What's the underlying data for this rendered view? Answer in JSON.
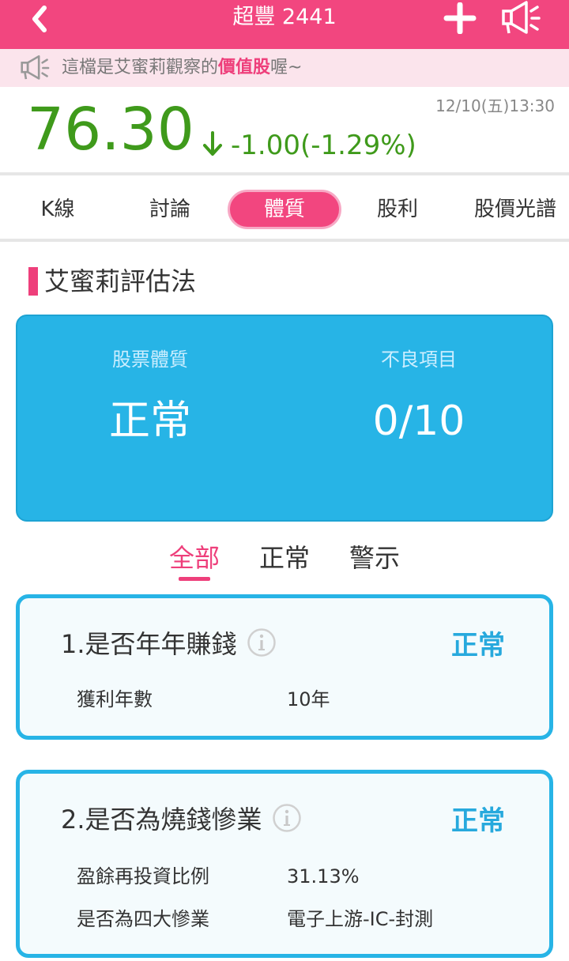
{
  "header": {
    "title": "超豐 2441",
    "back_icon": "chevron-left-icon",
    "add_icon": "plus-icon",
    "announce_icon": "megaphone-icon"
  },
  "notice": {
    "prefix": "這檔是艾蜜莉觀察的",
    "highlight": "價值股",
    "suffix": "喔~"
  },
  "quote": {
    "price": "76.30",
    "change": "-1.00(-1.29%)",
    "timestamp": "12/10(五)13:30"
  },
  "tabs": [
    {
      "label": "K線",
      "active": false
    },
    {
      "label": "討論",
      "active": false
    },
    {
      "label": "體質",
      "active": true
    },
    {
      "label": "股利",
      "active": false
    },
    {
      "label": "股價光譜",
      "active": false
    }
  ],
  "section": {
    "title": "艾蜜莉評估法"
  },
  "summary": {
    "left_label": "股票體質",
    "left_value": "正常",
    "right_label": "不良項目",
    "right_value": "0/10"
  },
  "filters": [
    {
      "label": "全部",
      "active": true
    },
    {
      "label": "正常",
      "active": false
    },
    {
      "label": "警示",
      "active": false
    }
  ],
  "cards": [
    {
      "title": "1.是否年年賺錢",
      "status": "正常",
      "rows": [
        {
          "key": "獲利年數",
          "value": "10年"
        }
      ]
    },
    {
      "title": "2.是否為燒錢慘業",
      "status": "正常",
      "rows": [
        {
          "key": "盈餘再投資比例",
          "value": "31.13%"
        },
        {
          "key": "是否為四大慘業",
          "value": "電子上游-IC-封測"
        }
      ]
    }
  ],
  "colors": {
    "brand": "#f2467f",
    "down": "#3f9a1b",
    "accent_blue": "#27b4e6"
  }
}
